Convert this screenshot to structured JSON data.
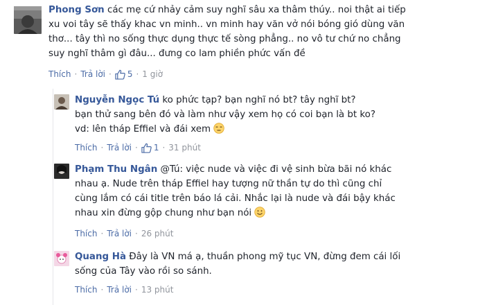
{
  "comments": [
    {
      "author": "Phong Sơn",
      "lines": [
        "các mẹ cứ nhảy cảm suy nghĩ sâu xa thâm thúy.. noi thật ai tiếp",
        "xu voi tây sẽ thấy khac vn minh.. vn minh hay văn vở nói bóng gió dùng văn",
        "thơ... tây thì no sống thực dụng thực tế sòng phẳng.. no vô tư chứ no chẳng",
        "suy nghĩ thâm gì đâu... đưng co lam phiền phức vấn đề"
      ],
      "like_label": "Thích",
      "reply_label": "Trả lời",
      "likes": "5",
      "time": "1 giờ"
    },
    {
      "author": "Nguyễn Ngọc Tú",
      "lines": [
        "ko phức tạp? bạn nghĩ nó bt? tây nghĩ bt?",
        "bạn thử sang bên đó và làm như vậy xem họ có coi bạn là bt ko?",
        "vd: lên tháp Effiel và đái xem"
      ],
      "emoji": "unamused-face-emoji",
      "like_label": "Thích",
      "reply_label": "Trả lời",
      "likes": "1",
      "time": "31 phút"
    },
    {
      "author": "Phạm Thu Ngân",
      "lines": [
        "@Tú: việc nude và việc đi vệ sinh bừa bãi nó khác",
        "nhau ạ. Nude trên tháp Effiel hay tượng nữ thần tự do thì cũng chỉ",
        "cùng lắm có cái title trên báo lá cải. Nhắc lại là nude và đái bậy khác",
        "nhau xin đừng gộp chung như bạn nói"
      ],
      "emoji": "smile-emoji",
      "like_label": "Thích",
      "reply_label": "Trả lời",
      "time": "26 phút"
    },
    {
      "author": "Quang Hà",
      "lines": [
        "Đây là VN má ạ, thuần phong mỹ tục VN, đừng đem cái lối",
        "sống của Tây vào rồi so sánh."
      ],
      "like_label": "Thích",
      "reply_label": "Trả lời",
      "time": "13 phút"
    }
  ],
  "colors": {
    "author": "#365899",
    "action": "#4b6ba6",
    "meta": "#90949c",
    "text": "#1d2129"
  }
}
